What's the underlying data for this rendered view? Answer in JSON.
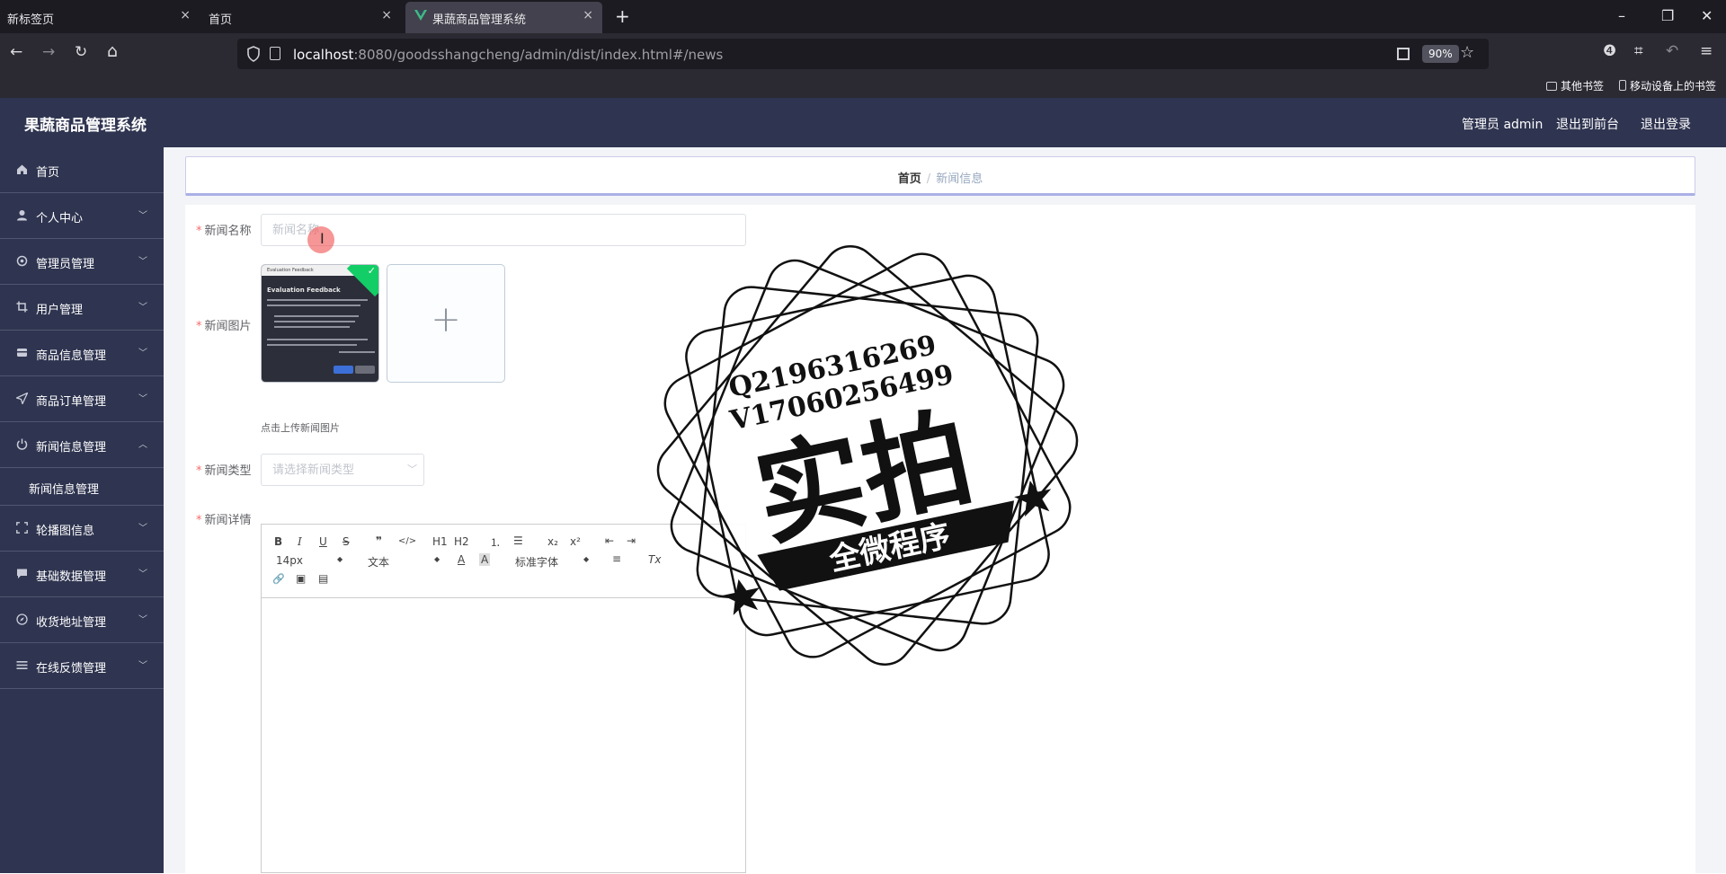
{
  "browser": {
    "tabs": [
      {
        "label": "新标签页",
        "close": "×"
      },
      {
        "label": "首页",
        "close": "×"
      },
      {
        "label": "果蔬商品管理系统",
        "close": "×"
      }
    ],
    "new_tab": "+",
    "window_controls": {
      "minimize": "–",
      "restore": "❐",
      "close": "✕"
    },
    "nav": {
      "back": "←",
      "forward": "→",
      "reload": "↻",
      "home": "⌂"
    },
    "url_host": "localhost",
    "url_rest": ":8080/goodsshangcheng/admin/dist/index.html#/news",
    "zoom": "90%",
    "star": "☆",
    "toolbar_icons": {
      "account": "❹",
      "crop": "⌗",
      "undo": "↶",
      "menu": "≡"
    },
    "bookmarks": [
      {
        "label": "其他书签",
        "icon": "folder-icon"
      },
      {
        "label": "移动设备上的书签",
        "icon": "phone-icon"
      }
    ]
  },
  "header": {
    "title": "果蔬商品管理系统",
    "user": "管理员 admin",
    "to_front": "退出到前台",
    "logout": "退出登录"
  },
  "sidebar": {
    "items": [
      {
        "label": "首页",
        "icon": "home-icon",
        "arrow": ""
      },
      {
        "label": "个人中心",
        "icon": "user-icon",
        "arrow": "﹀"
      },
      {
        "label": "管理员管理",
        "icon": "settings-icon",
        "arrow": "﹀"
      },
      {
        "label": "用户管理",
        "icon": "crop-icon",
        "arrow": "﹀"
      },
      {
        "label": "商品信息管理",
        "icon": "goods-icon",
        "arrow": "﹀"
      },
      {
        "label": "商品订单管理",
        "icon": "send-icon",
        "arrow": "﹀"
      },
      {
        "label": "新闻信息管理",
        "icon": "power-icon",
        "arrow": "︿"
      },
      {
        "label": "轮播图信息",
        "icon": "fullscreen-icon",
        "arrow": "﹀"
      },
      {
        "label": "基础数据管理",
        "icon": "chat-icon",
        "arrow": "﹀"
      },
      {
        "label": "收货地址管理",
        "icon": "compass-icon",
        "arrow": "﹀"
      },
      {
        "label": "在线反馈管理",
        "icon": "list-icon",
        "arrow": "﹀"
      }
    ],
    "submenu": {
      "label": "新闻信息管理"
    }
  },
  "breadcrumb": {
    "home": "首页",
    "sep": "/",
    "current": "新闻信息"
  },
  "form": {
    "required_mark": "*",
    "name_label": "新闻名称",
    "name_placeholder": "新闻名称",
    "image_label": "新闻图片",
    "upload_plus": "+",
    "upload_tip": "点击上传新闻图片",
    "type_label": "新闻类型",
    "type_placeholder": "请选择新闻类型",
    "detail_label": "新闻详情"
  },
  "thumbnail": {
    "app_bar": "Evaluation Feedback",
    "heading": "Evaluation Feedback"
  },
  "editor": {
    "bold": "B",
    "italic": "I",
    "underline": "U",
    "strike": "S",
    "quote": "❞",
    "code": "</>",
    "h1": "H1",
    "h2": "H2",
    "ordered": "⒈",
    "bullet": "☰",
    "sub": "x₂",
    "sup": "x²",
    "outdent": "⇤",
    "indent": "⇥",
    "size": "14px",
    "text": "文本",
    "font": "标准字体",
    "align": "≡",
    "clean": "Tx",
    "link": "🔗",
    "image": "▣",
    "video": "▤"
  },
  "stamp": {
    "line1": "Q2196316269",
    "line2": "V17060256499",
    "main": "实拍",
    "ribbon": "全微程序"
  },
  "colors": {
    "header_bg": "#2f3450",
    "sidebar_bg": "#2f3450",
    "required": "#f56c6c",
    "success": "#13ce66"
  }
}
